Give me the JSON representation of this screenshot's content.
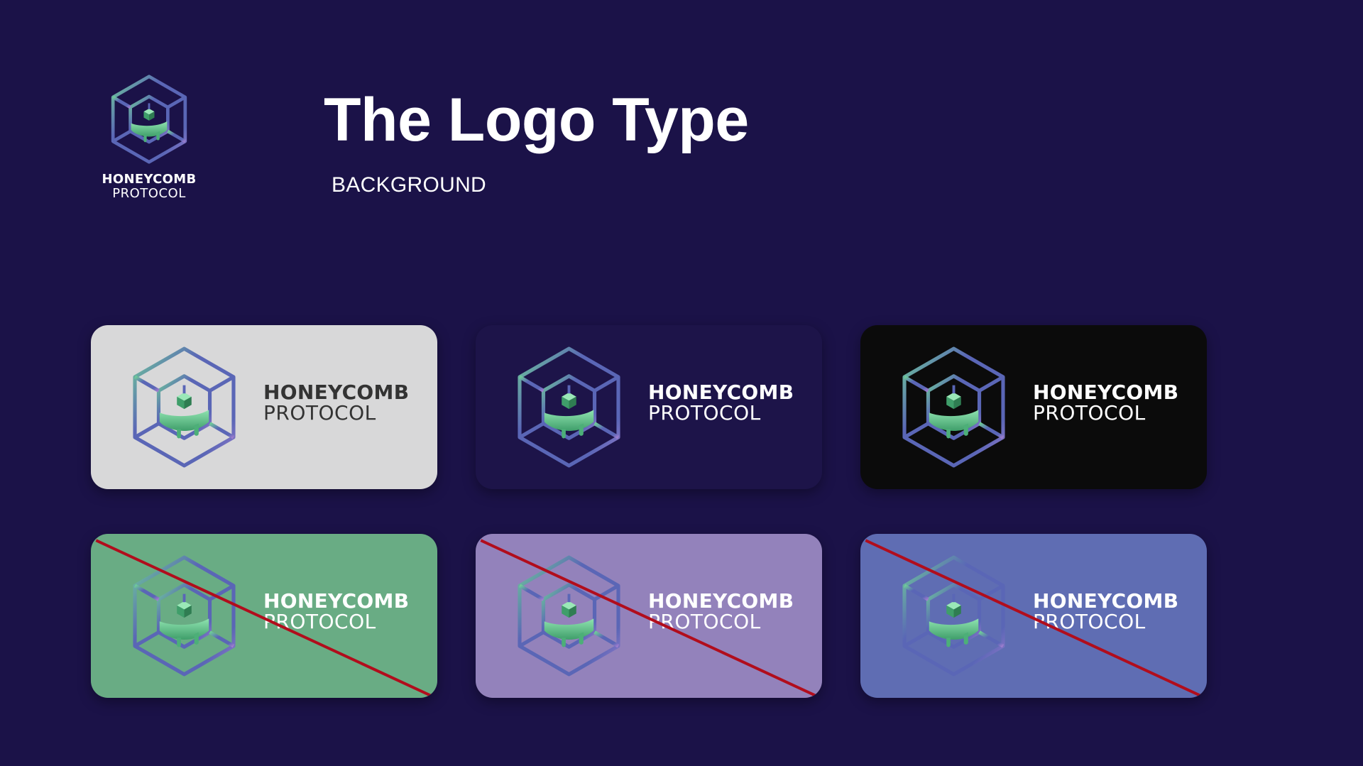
{
  "brand": {
    "word1": "HONEYCOMB",
    "word2": "PROTOCOL"
  },
  "header": {
    "title": "The Logo Type",
    "subtitle": "BACKGROUND"
  },
  "cards": [
    {
      "background": "light-gray",
      "bg_color": "#d8d8d9",
      "text_color": "#333333",
      "approved": true,
      "crossed_out": false
    },
    {
      "background": "deep-purple",
      "bg_color": "#1d1449",
      "text_color": "#ffffff",
      "approved": true,
      "crossed_out": false
    },
    {
      "background": "black",
      "bg_color": "#0b0b0b",
      "text_color": "#ffffff",
      "approved": true,
      "crossed_out": false
    },
    {
      "background": "green",
      "bg_color": "#69ac84",
      "text_color": "#ffffff",
      "approved": false,
      "crossed_out": true
    },
    {
      "background": "lavender",
      "bg_color": "#9382bb",
      "text_color": "#ffffff",
      "approved": false,
      "crossed_out": true
    },
    {
      "background": "periwinkle",
      "bg_color": "#5f6db3",
      "text_color": "#ffffff",
      "approved": false,
      "crossed_out": true
    }
  ],
  "colors": {
    "page_background": "#1b1248",
    "logo_blue": "#5a66b6",
    "logo_green": "#6fcf97",
    "logo_violet": "#9d7fcf",
    "goo_green": "#4caf78",
    "strike_red": "#b10d1c"
  },
  "icons": {
    "logo": "honeycomb-cube-logo-icon",
    "strike": "red-diagonal-strike"
  }
}
